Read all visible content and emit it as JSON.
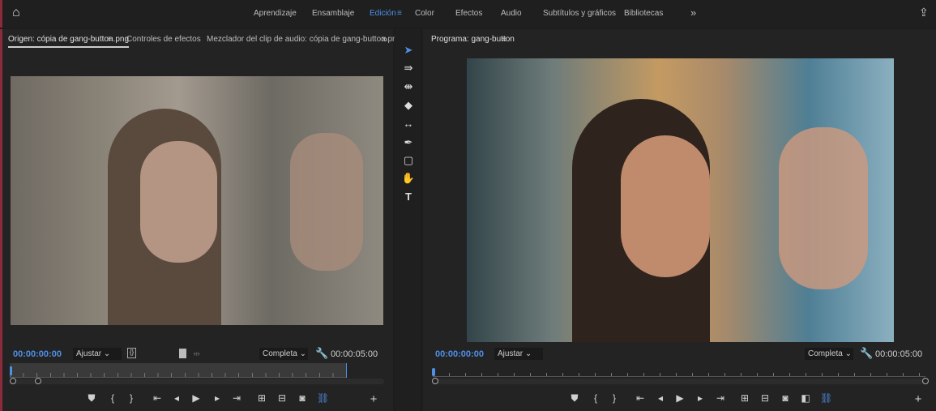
{
  "topbar": {
    "workspaces": [
      "Aprendizaje",
      "Ensamblaje",
      "Edición",
      "Color",
      "Efectos",
      "Audio",
      "Subtítulos y gráficos",
      "Bibliotecas"
    ],
    "active": "Edición",
    "more": "»"
  },
  "source": {
    "tabs": [
      "Origen: cópia de gang-button.png",
      "Controles de efectos",
      "Mezclador del clip de audio: cópia de gang-button.png"
    ],
    "more": "»",
    "timecode": "00:00:00:00",
    "zoom": "Ajustar",
    "quality": "Completa",
    "duration": "00:00:05:00"
  },
  "program": {
    "tab": "Programa: gang-button",
    "timecode": "00:00:00:00",
    "zoom": "Ajustar",
    "quality": "Completa",
    "duration": "00:00:05:00"
  },
  "colors": {
    "accent": "#4f8fe6",
    "bg": "#232323"
  }
}
